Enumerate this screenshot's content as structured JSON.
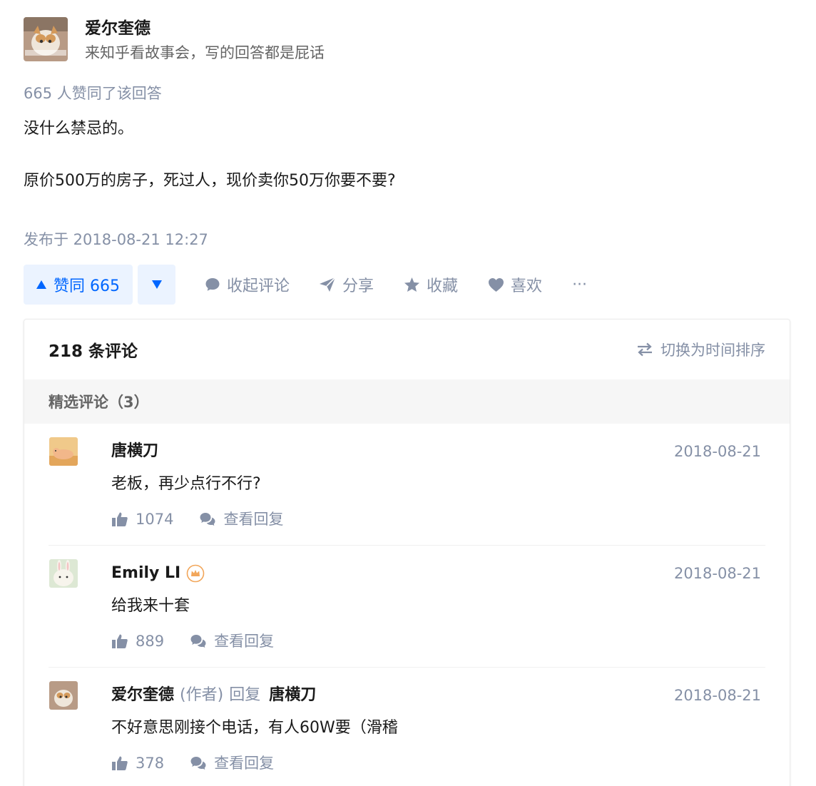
{
  "author": {
    "name": "爱尔奎德",
    "bio": "来知乎看故事会，写的回答都是屁话"
  },
  "answer": {
    "votes_summary": "665 人赞同了该回答",
    "paragraphs": [
      "没什么禁忌的。",
      "原价500万的房子，死过人，现价卖你50万你要不要?"
    ],
    "published": "发布于 2018-08-21 12:27"
  },
  "actions": {
    "vote_up": "赞同 665",
    "collapse_comments": "收起评论",
    "share": "分享",
    "favorite": "收藏",
    "like": "喜欢",
    "more": "···"
  },
  "comments": {
    "count_title": "218 条评论",
    "sort_toggle": "切换为时间排序",
    "section_title": "精选评论（3）",
    "items": [
      {
        "name": "唐横刀",
        "date": "2018-08-21",
        "text": "老板，再少点行不行?",
        "likes": "1074",
        "view_replies": "查看回复"
      },
      {
        "name": "Emily LI",
        "date": "2018-08-21",
        "text": "给我来十套",
        "likes": "889",
        "view_replies": "查看回复"
      },
      {
        "name": "爱尔奎德",
        "author_tag": "(作者)",
        "reply_word": "回复",
        "reply_to": "唐横刀",
        "date": "2018-08-21",
        "text": "不好意思刚接个电话，有人60W要（滑稽",
        "likes": "378",
        "view_replies": "查看回复"
      }
    ]
  },
  "colors": {
    "brand_blue": "#0066ff",
    "vote_bg": "#ebf3ff",
    "meta_gray": "#8590a6"
  }
}
